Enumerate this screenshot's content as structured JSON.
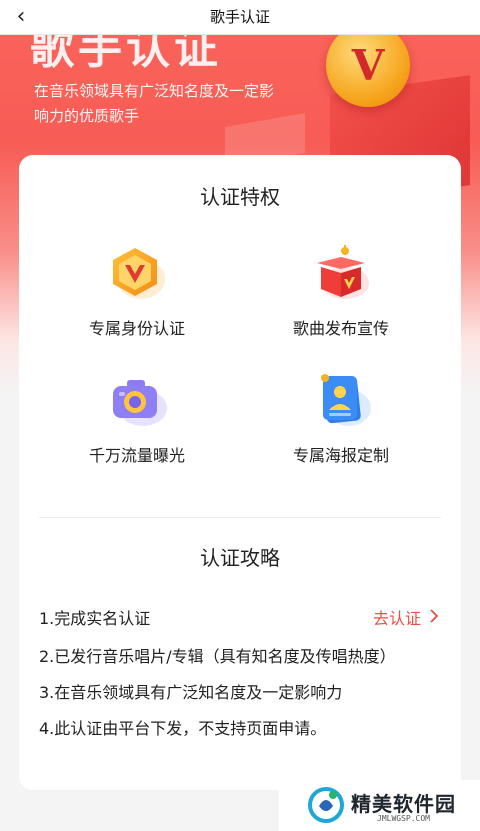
{
  "nav": {
    "back_icon": "chevron-left-icon",
    "title": "歌手认证"
  },
  "hero": {
    "big_title": "歌手认证",
    "description": "在音乐领域具有广泛知名度及一定影响力的优质歌手",
    "badge_letter": "V",
    "colors": {
      "gradient_top": "#f9635a",
      "gradient_bottom": "#f4f4f4"
    }
  },
  "privileges": {
    "title": "认证特权",
    "items": [
      {
        "label": "专属身份认证",
        "icon": "v-badge-icon"
      },
      {
        "label": "歌曲发布宣传",
        "icon": "gift-box-icon"
      },
      {
        "label": "千万流量曝光",
        "icon": "camera-icon"
      },
      {
        "label": "专属海报定制",
        "icon": "poster-icon"
      }
    ]
  },
  "guide": {
    "title": "认证攻略",
    "steps": [
      "1.完成实名认证",
      "2.已发行音乐唱片/专辑（具有知名度及传唱热度）",
      "3.在音乐领域具有广泛知名度及一定影响力",
      "4.此认证由平台下发，不支持页面申请。"
    ],
    "action_label": "去认证",
    "action_color": "#f04e45"
  },
  "watermark": {
    "name": "精美软件园",
    "url": "JMLWGSP.COM"
  }
}
